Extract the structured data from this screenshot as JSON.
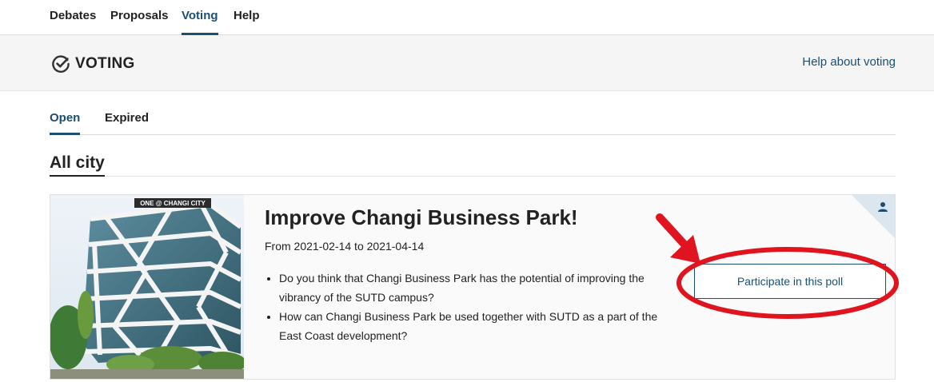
{
  "nav": {
    "items": [
      {
        "label": "Debates",
        "active": false
      },
      {
        "label": "Proposals",
        "active": false
      },
      {
        "label": "Voting",
        "active": true
      },
      {
        "label": "Help",
        "active": false
      }
    ]
  },
  "header": {
    "icon": "check-circle-icon",
    "title": "VOTING",
    "help_link": "Help about voting"
  },
  "tabs": [
    {
      "label": "Open",
      "active": true
    },
    {
      "label": "Expired",
      "active": false
    }
  ],
  "section": {
    "title": "All city"
  },
  "poll": {
    "title": "Improve Changi Business Park!",
    "dates": "From 2021-02-14 to 2021-04-14",
    "questions": [
      "Do you think that Changi Business Park has the potential of improving the vibrancy of the SUTD campus?",
      "How can Changi Business Park be used together with SUTD as a part of the East Coast development?"
    ],
    "participate_label": "Participate in this poll",
    "image_sign": "ONE @ CHANGI CITY",
    "badge_icon": "user-icon"
  },
  "colors": {
    "accent": "#1a4f73",
    "annotation": "#e0141e"
  }
}
